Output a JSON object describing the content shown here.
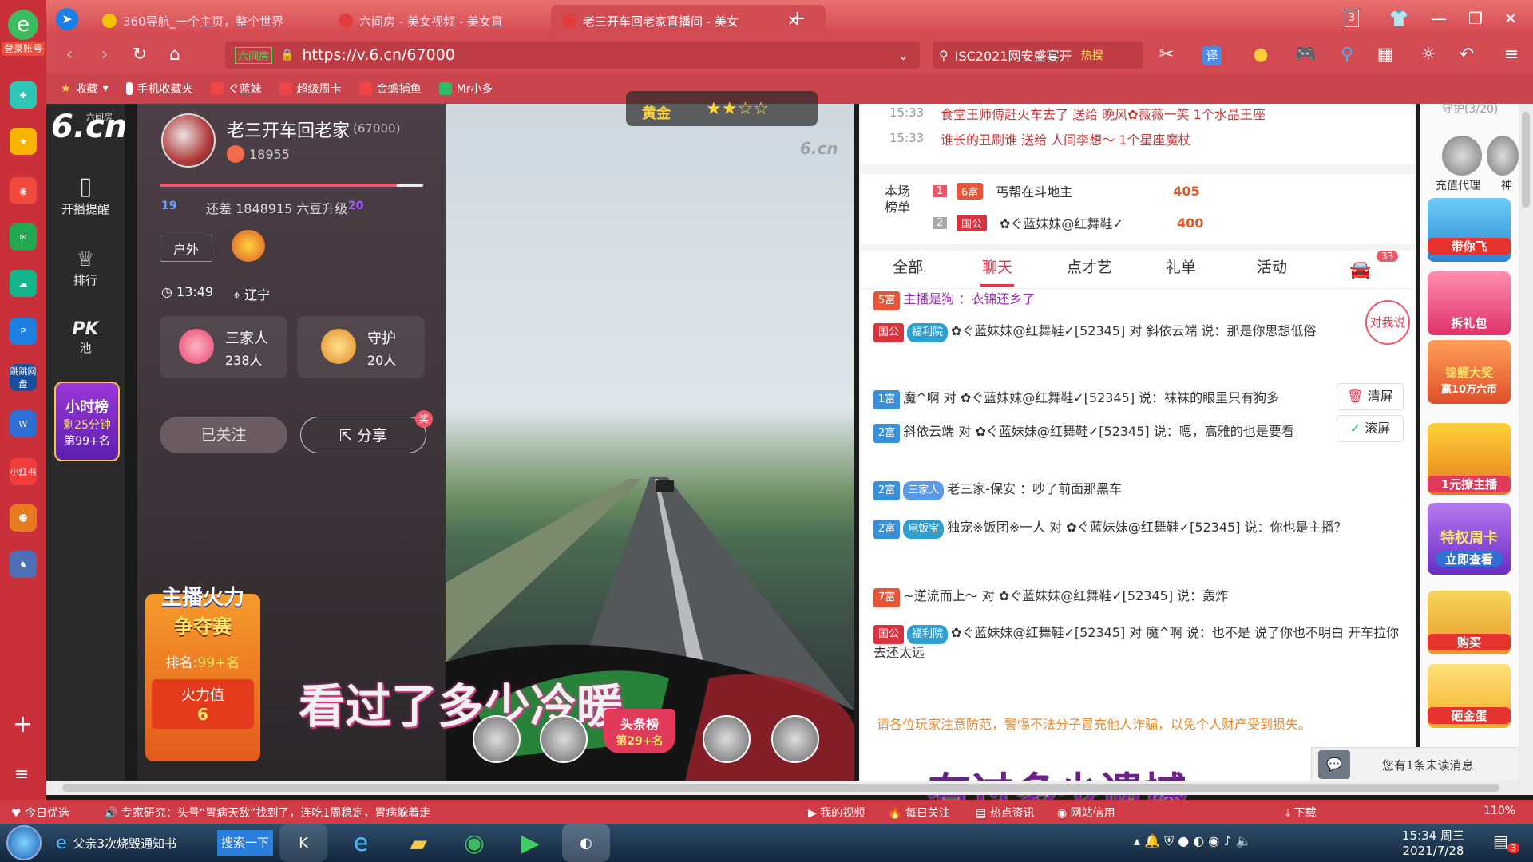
{
  "browser": {
    "tabs": [
      {
        "label": "360导航_一个主页，整个世界"
      },
      {
        "label": "六间房 - 美女视频 - 美女直"
      },
      {
        "label": "老三开车回老家直播间 - 美女"
      }
    ],
    "tab_counter": "3",
    "url_site_label": "六间房",
    "url": "https://v.6.cn/67000",
    "search_text": "ISC2021网安盛宴开",
    "search_hot": "热搜",
    "translate": "译"
  },
  "bookmarks": [
    "收藏",
    "手机收藏夹",
    "ぐ蓝妹",
    "超级周卡",
    "金蟾捕鱼",
    "Mr小多"
  ],
  "leftbar": {
    "login": "登录账号",
    "apps": [
      "跳跳网盘",
      "小红书"
    ]
  },
  "sitenav": {
    "logo": "6.cn",
    "logo_sub": "六间房",
    "items": [
      "开播提醒",
      "排行",
      "PK池"
    ],
    "hour_rank": {
      "title": "小时榜",
      "remain": "剩25分钟",
      "rank": "第99+名"
    }
  },
  "streamer": {
    "name": "老三开车回老家",
    "room_id": "(67000)",
    "fans": "18955",
    "level_from": "19",
    "level_gap": "还差 1848915 六豆升级",
    "level_to": "20",
    "tag": "户外",
    "time": "13:49",
    "location": "辽宁",
    "family_label": "三家人",
    "family_count": "238人",
    "guard_label": "守护",
    "guard_count": "20人",
    "follow_btn": "已关注",
    "share_btn": "分享",
    "share_badge": "奖"
  },
  "fire": {
    "title1": "主播火力",
    "title2": "争夺赛",
    "rank": "排名:",
    "rank_val": "99+名",
    "value_label": "火力值",
    "value": "6"
  },
  "video": {
    "watermark": "6.cn",
    "badge": "黄金",
    "stars": "★★☆☆",
    "caption1": "看过了多少冷暖",
    "caption2": "有过多少遗憾",
    "headline_title": "头条榜",
    "headline_rank": "第29+名"
  },
  "gift_feed": [
    {
      "time": "15:33",
      "text": "食堂王师傅赶火车去了 送给 晚风✿薇薇一笑 1个水晶王座"
    },
    {
      "time": "15:33",
      "text": "谁长的丑刷谁 送给 人间李想～ 1个星座魔杖"
    }
  ],
  "ranking": {
    "title": "本场榜单",
    "rows": [
      {
        "rank": "1",
        "badge": "6富",
        "name": "丐帮在斗地主",
        "score": "405"
      },
      {
        "rank": "2",
        "badge": "国公",
        "name": "✿ぐ蓝妹妹@红舞鞋✓",
        "score": "400"
      }
    ]
  },
  "chat_tabs": [
    "全部",
    "聊天",
    "点才艺",
    "礼单",
    "活动"
  ],
  "car_badge": "33",
  "chat": [
    {
      "badge": "5富",
      "text": "主播是狗 ：衣锦还乡了"
    },
    {
      "badge": "国公",
      "fan": "福利院",
      "text": "✿ぐ蓝妹妹@红舞鞋✓[52345] 对 斜依云端 说：那是你思想低俗"
    },
    {
      "badge": "1富",
      "text": "魔^啊 对 ✿ぐ蓝妹妹@红舞鞋✓[52345] 说：袜袜的眼里只有狗多"
    },
    {
      "badge": "2富",
      "text": "斜依云端 对 ✿ぐ蓝妹妹@红舞鞋✓[52345] 说：嗯，高雅的也是要看"
    },
    {
      "badge": "2富",
      "fan": "三家人",
      "text": "老三家-保安 ：吵了前面那黑车"
    },
    {
      "badge": "2富",
      "fan": "电饭宝",
      "text": "独宠※饭团※一人 对 ✿ぐ蓝妹妹@红舞鞋✓[52345] 说：你也是主播？"
    },
    {
      "badge": "7富",
      "text": "~逆流而上～ 对 ✿ぐ蓝妹妹@红舞鞋✓[52345] 说：轰炸"
    },
    {
      "badge": "国公",
      "fan": "福利院",
      "text": "✿ぐ蓝妹妹@红舞鞋✓[52345] 对 魔^啊 说：也不是 说了你也不明白 开车拉你去还太远"
    }
  ],
  "chat_side": {
    "talk": "对我说",
    "clear": "清屏",
    "scroll": "滚屏"
  },
  "notice": "请各位玩家注意防范，警惕不法分子冒充他人诈骗，以免个人财产受到损失。",
  "unread": "您有1条未读消息",
  "rail": {
    "guard_title": "守护(3/20)",
    "labels": [
      "充值代理",
      "神",
      "带你飞",
      "拆礼包",
      "锦鲤大奖",
      "赢10万六币",
      "1元撩主播",
      "特权周卡",
      "立即查看",
      "购买",
      "砸金蛋"
    ]
  },
  "statusbar": {
    "left1": "今日优选",
    "news": "专家研究：头号“胃病天敌”找到了，连吃1周稳定，胃病躲着走",
    "items": [
      "我的视频",
      "每日关注",
      "热点资讯",
      "网站信用",
      "下载"
    ],
    "zoom": "110%"
  },
  "taskbar": {
    "task1": "父亲3次烧毁通知书",
    "search": "搜索一下",
    "time": "15:34 周三",
    "date": "2021/7/28",
    "notif": "3"
  },
  "colors": {
    "accent": "#e1364e",
    "browser_red": "#d24a52",
    "purple_name": "#9b2fb0"
  }
}
